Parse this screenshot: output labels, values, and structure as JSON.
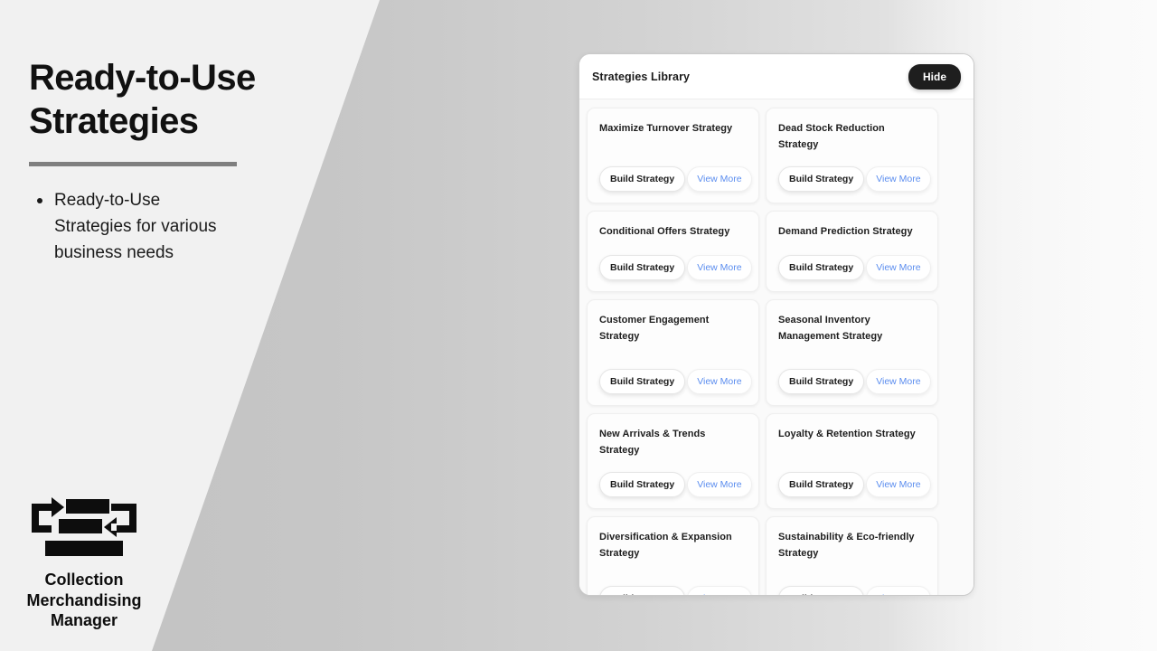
{
  "slide": {
    "title": "Ready-to-Use Strategies",
    "bullets": [
      "Ready-to-Use Strategies for various business needs"
    ]
  },
  "logo": {
    "icon": "exchange-arrows-icon",
    "caption": "Collection Merchandising Manager"
  },
  "panel": {
    "title": "Strategies Library",
    "hide_label": "Hide",
    "build_label": "Build Strategy",
    "view_more_label": "View More",
    "cards": [
      {
        "title": "Maximize Turnover Strategy",
        "lines": 1
      },
      {
        "title": "Dead Stock Reduction Strategy",
        "lines": 1
      },
      {
        "title": "Conditional Offers Strategy",
        "lines": 1
      },
      {
        "title": "Demand Prediction Strategy",
        "lines": 1
      },
      {
        "title": "Customer Engagement Strategy",
        "lines": 2
      },
      {
        "title": "Seasonal Inventory Management Strategy",
        "lines": 2
      },
      {
        "title": "New Arrivals & Trends Strategy",
        "lines": 1
      },
      {
        "title": "Loyalty & Retention Strategy",
        "lines": 1
      },
      {
        "title": "Diversification & Expansion Strategy",
        "lines": 2
      },
      {
        "title": "Sustainability & Eco-friendly Strategy",
        "lines": 2
      }
    ]
  },
  "colors": {
    "accent_link": "#5b8def",
    "dark_button": "#1e1e1e",
    "divider": "#7f7f7f",
    "background": "#f1f1f1",
    "wedge": "#c2c2c2"
  }
}
